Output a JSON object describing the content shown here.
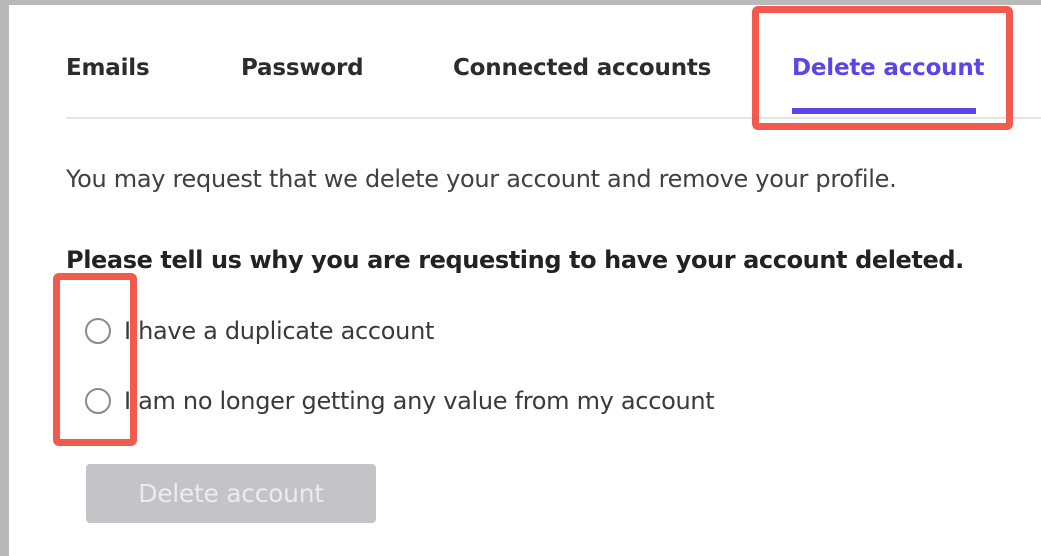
{
  "tabs": {
    "items": [
      {
        "label": "Emails",
        "active": false
      },
      {
        "label": "Password",
        "active": false
      },
      {
        "label": "Connected accounts",
        "active": false
      },
      {
        "label": "Delete account",
        "active": true
      }
    ]
  },
  "content": {
    "intro": "You may request that we delete your account and remove your profile.",
    "question": "Please tell us why you are requesting to have your account deleted.",
    "options": [
      {
        "label": "I have a duplicate account",
        "checked": false
      },
      {
        "label": "I am no longer getting any value from my account",
        "checked": false
      }
    ],
    "submit_label": "Delete account",
    "submit_disabled": true
  },
  "colors": {
    "accent": "#5a45e8",
    "highlight": "#f25a50",
    "disabled_button": "#c4c4c8"
  }
}
